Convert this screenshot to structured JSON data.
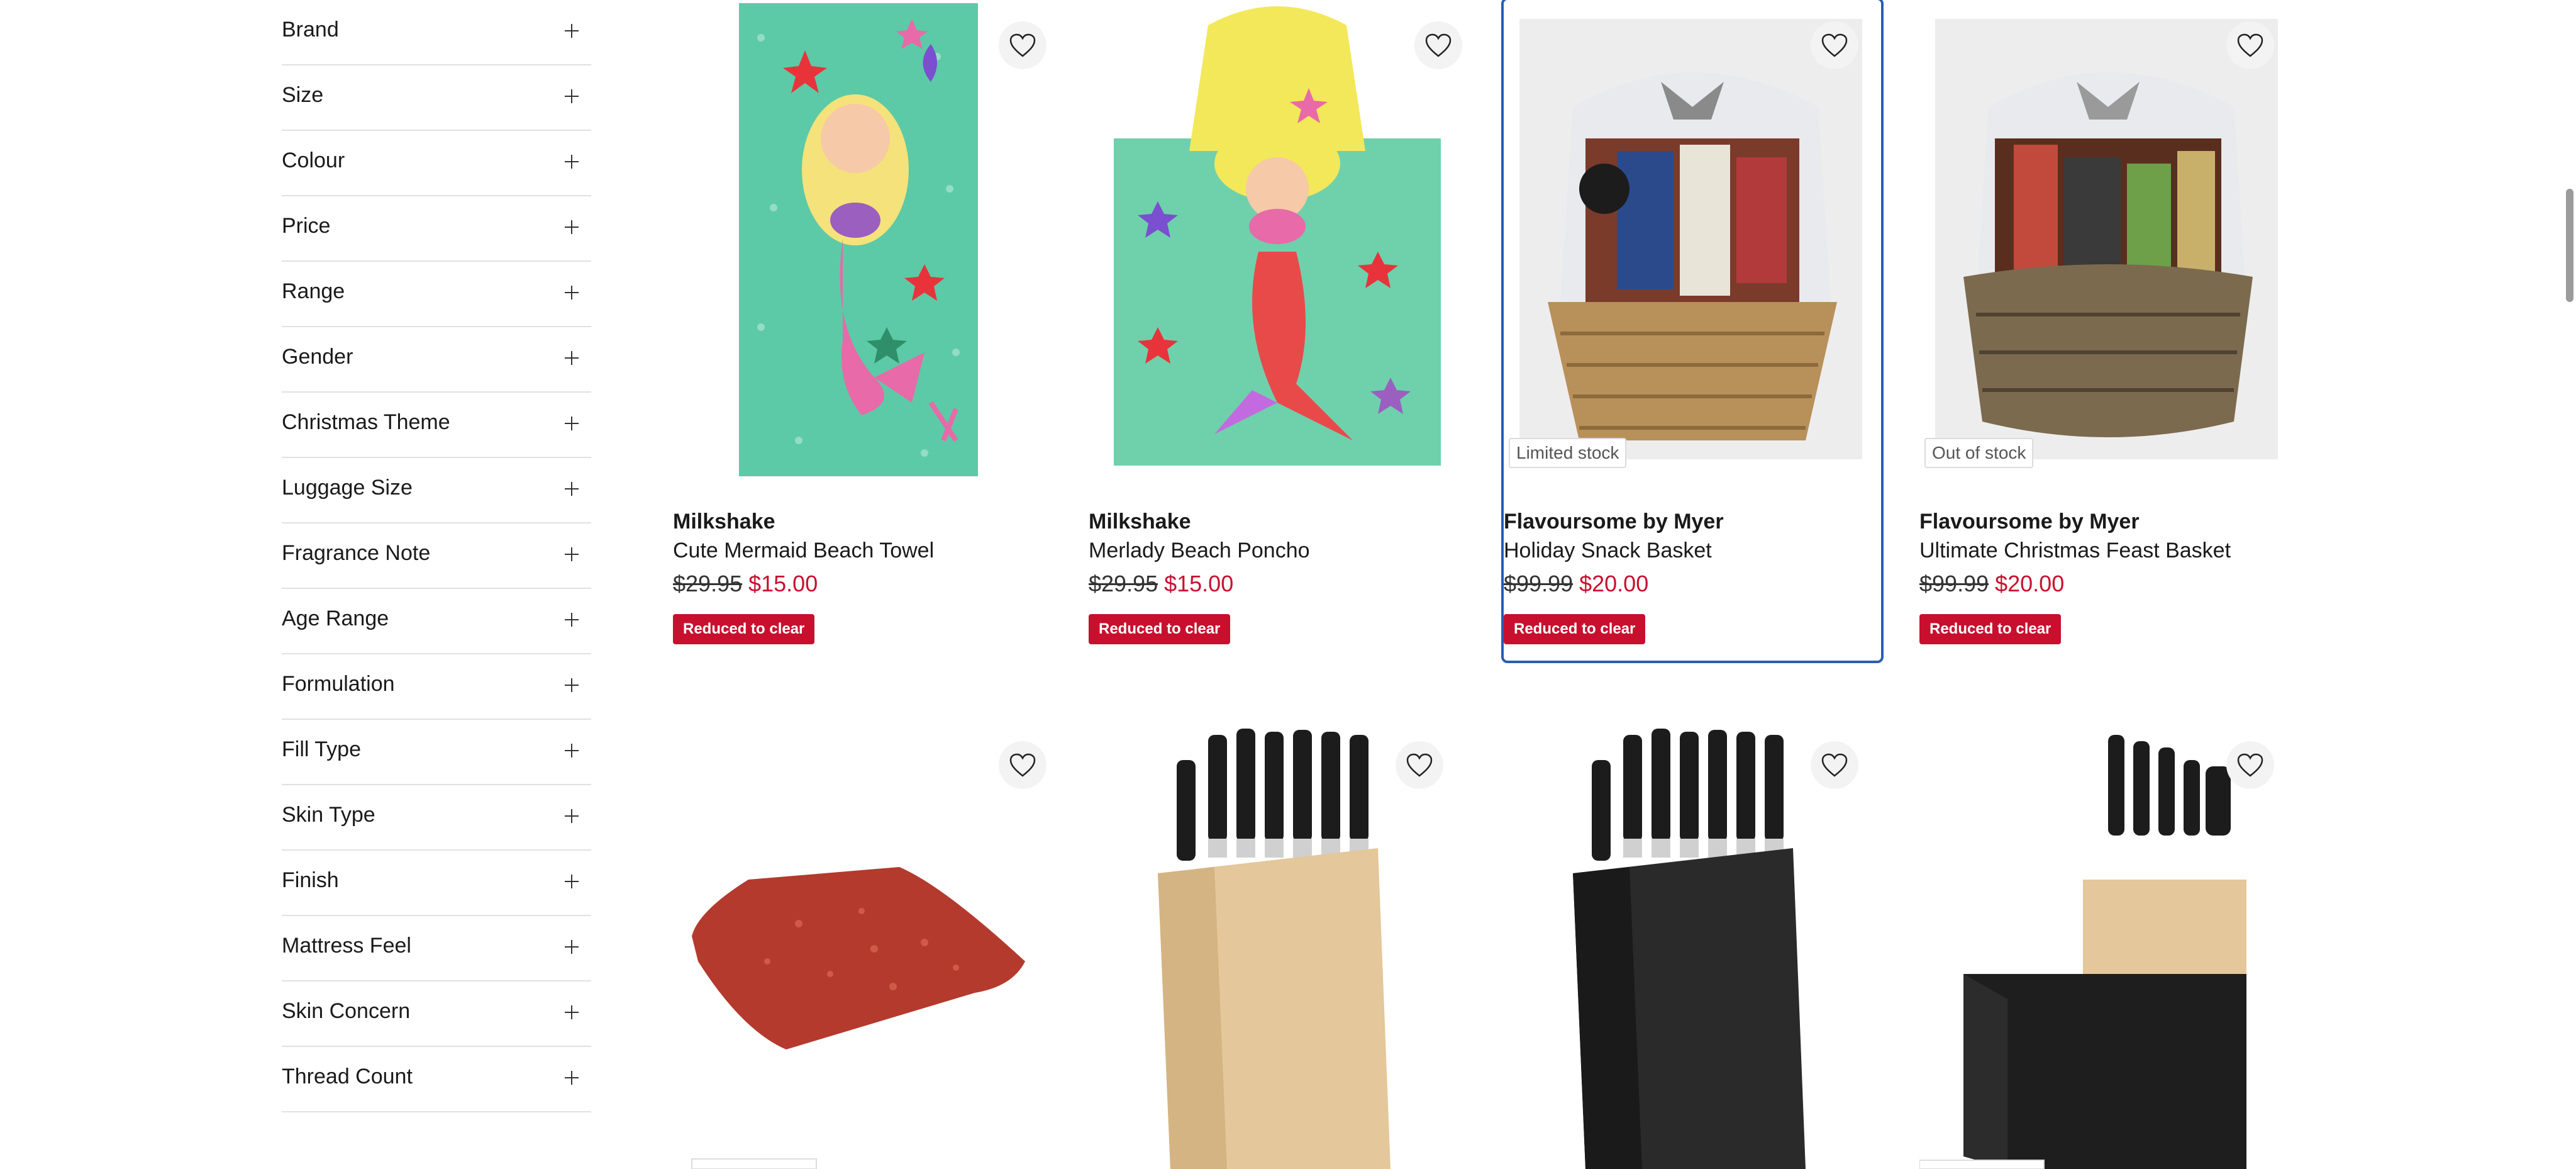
{
  "filters": [
    {
      "label": "Brand"
    },
    {
      "label": "Size"
    },
    {
      "label": "Colour"
    },
    {
      "label": "Price"
    },
    {
      "label": "Range"
    },
    {
      "label": "Gender"
    },
    {
      "label": "Christmas Theme"
    },
    {
      "label": "Luggage Size"
    },
    {
      "label": "Fragrance Note"
    },
    {
      "label": "Age Range"
    },
    {
      "label": "Formulation"
    },
    {
      "label": "Fill Type"
    },
    {
      "label": "Skin Type"
    },
    {
      "label": "Finish"
    },
    {
      "label": "Mattress Feel"
    },
    {
      "label": "Skin Concern"
    },
    {
      "label": "Thread Count"
    }
  ],
  "products": [
    {
      "brand": "Milkshake",
      "title": "Cute Mermaid Beach Towel",
      "was_price": "$29.95",
      "now_price": "$15.00",
      "badge": "Reduced to clear",
      "stock": ""
    },
    {
      "brand": "Milkshake",
      "title": "Merlady Beach Poncho",
      "was_price": "$29.95",
      "now_price": "$15.00",
      "badge": "Reduced to clear",
      "stock": ""
    },
    {
      "brand": "Flavoursome by Myer",
      "title": "Holiday Snack Basket",
      "was_price": "$99.99",
      "now_price": "$20.00",
      "badge": "Reduced to clear",
      "stock": "Limited stock"
    },
    {
      "brand": "Flavoursome by Myer",
      "title": "Ultimate Christmas Feast Basket",
      "was_price": "$99.99",
      "now_price": "$20.00",
      "badge": "Reduced to clear",
      "stock": "Out of stock"
    }
  ],
  "colors": {
    "sale_red": "#c8102e",
    "focus_blue": "#2a5db0"
  }
}
